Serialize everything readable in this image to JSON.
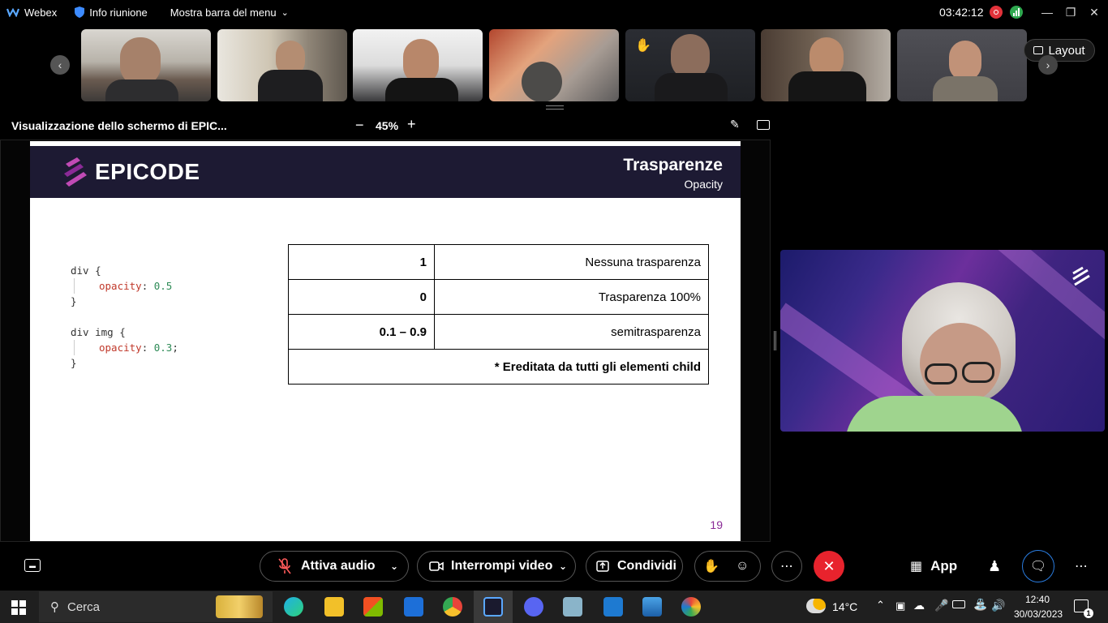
{
  "topbar": {
    "app_name": "Webex",
    "meeting_info": "Info riunione",
    "menu_bar": "Mostra barra del menu",
    "clock": "03:42:12"
  },
  "strip": {
    "layout_label": "Layout",
    "participants": [
      {
        "label": "participant-1"
      },
      {
        "label": "participant-2"
      },
      {
        "label": "participant-3"
      },
      {
        "label": "participant-4"
      },
      {
        "label": "participant-5"
      },
      {
        "label": "participant-6"
      },
      {
        "label": "participant-7"
      }
    ]
  },
  "share": {
    "title": "Visualizzazione dello schermo di EPIC...",
    "zoom": "45%"
  },
  "slide": {
    "brand": "EPICODE",
    "title": "Trasparenze",
    "subtitle": "Opacity",
    "code": {
      "l1": "div {",
      "l2_prop": "opacity",
      "l2_colon": ": ",
      "l2_val": "0.5",
      "l3": "}",
      "l4": "div img {",
      "l5_prop": "opacity",
      "l5_colon": ": ",
      "l5_val": "0.3",
      "l5_semi": ";",
      "l6": "}"
    },
    "table": {
      "r1_value": "1",
      "r1_desc": "Nessuna trasparenza",
      "r2_value": "0",
      "r2_desc": "Trasparenza 100%",
      "r3_value": "0.1 – 0.9",
      "r3_desc": "semitrasparenza",
      "note": "* Ereditata da tutti gli elementi child"
    },
    "page_number": "19"
  },
  "toolbar": {
    "audio": "Attiva audio",
    "video": "Interrompi video",
    "share": "Condividi",
    "app": "App"
  },
  "taskbar": {
    "search": "Cerca",
    "weather": "14°C",
    "time": "12:40",
    "date": "30/03/2023",
    "notifications": "1"
  },
  "colors": {
    "slide_header": "#1d1a33",
    "accent": "#8a2a96",
    "end_call": "#e8232d",
    "code_prop": "#c0392b",
    "code_val": "#2e8b57"
  }
}
